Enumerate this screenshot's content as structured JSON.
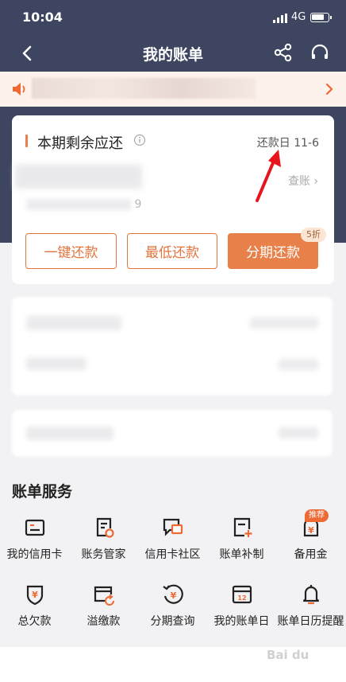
{
  "statusbar": {
    "time": "10:04",
    "network": "4G"
  },
  "navbar": {
    "title": "我的账单",
    "back_icon": "chevron-left-icon",
    "share_icon": "share-icon",
    "service_icon": "headset-icon"
  },
  "notice": {
    "text": "",
    "icon": "speaker-icon",
    "arrow_icon": "chevron-right-icon"
  },
  "bill_card": {
    "title": "本期剩余应还",
    "due_label": "还款日 11-6",
    "amount": "",
    "sub_suffix": "9",
    "check_label": "查账 ›",
    "discount_badge": "5折",
    "buttons": {
      "pay_all": "一键还款",
      "min_pay": "最低还款",
      "installment": "分期还款"
    }
  },
  "services": {
    "title": "账单服务",
    "items": [
      {
        "label": "我的信用卡",
        "icon": "credit-card-icon"
      },
      {
        "label": "账务管家",
        "icon": "account-manager-icon"
      },
      {
        "label": "信用卡社区",
        "icon": "community-icon"
      },
      {
        "label": "账单补制",
        "icon": "bill-reissue-icon"
      },
      {
        "label": "备用金",
        "icon": "reserve-fund-icon"
      },
      {
        "label": "总欠款",
        "icon": "total-debt-icon"
      },
      {
        "label": "溢缴款",
        "icon": "overpayment-icon"
      },
      {
        "label": "分期查询",
        "icon": "installment-query-icon"
      },
      {
        "label": "我的账单日",
        "icon": "calendar-icon"
      },
      {
        "label": "账单日历提醒",
        "icon": "bell-icon"
      }
    ],
    "recommend_badge": "推荐",
    "calendar_day": "12",
    "yen_symbol": "¥"
  },
  "watermark": {
    "text": "Bai du"
  },
  "colors": {
    "header_bg": "#3e4560",
    "accent": "#e8804a",
    "page_bg": "#f2f2f4"
  }
}
